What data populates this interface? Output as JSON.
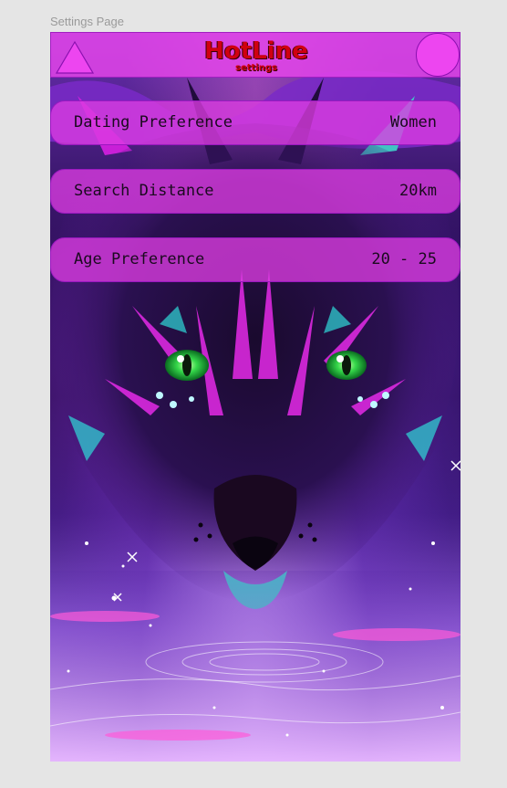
{
  "page_label": "Settings Page",
  "header": {
    "title": "HotLine",
    "subtitle": "settings",
    "back_icon": "triangle-icon",
    "profile_icon": "circle-icon"
  },
  "settings": [
    {
      "label": "Dating Preference",
      "value": "Women"
    },
    {
      "label": "Search Distance",
      "value": "20km"
    },
    {
      "label": "Age Preference",
      "value": "20 - 25"
    }
  ],
  "colors": {
    "header_bg": "#e846eb",
    "row_bg": "#dc3ce1",
    "title_red": "#d00010",
    "accent_green": "#2fe060"
  }
}
